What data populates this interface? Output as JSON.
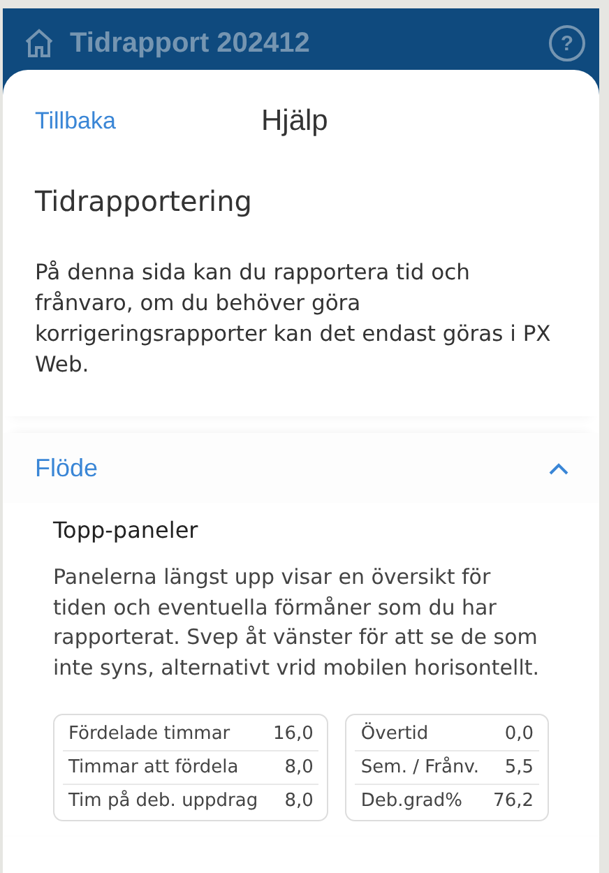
{
  "app_bar": {
    "title": "Tidrapport 202412",
    "help_icon": "?"
  },
  "sheet": {
    "back": "Tillbaka",
    "title": "Hjälp"
  },
  "intro": {
    "heading": "Tidrapportering",
    "text": "På denna sida kan du rapportera tid och frånvaro, om du behöver göra korrigeringsrapporter kan det endast göras i PX Web."
  },
  "section": {
    "title": "Flöde",
    "expanded": true,
    "subheading": "Topp-paneler",
    "text": "Panelerna längst upp visar en översikt för tiden och eventuella förmåner som du har rapporterat. Svep åt vänster för att se de som inte syns, alternativt vrid mobilen horisontellt.",
    "panels": [
      {
        "rows": [
          {
            "label": "Fördelade timmar",
            "value": "16,0"
          },
          {
            "label": "Timmar att fördela",
            "value": "8,0"
          },
          {
            "label": "Tim på deb. uppdrag",
            "value": "8,0"
          }
        ]
      },
      {
        "rows": [
          {
            "label": "Övertid",
            "value": "0,0"
          },
          {
            "label": "Sem. / Frånv.",
            "value": "5,5"
          },
          {
            "label": "Deb.grad%",
            "value": "76,2"
          }
        ]
      }
    ]
  }
}
